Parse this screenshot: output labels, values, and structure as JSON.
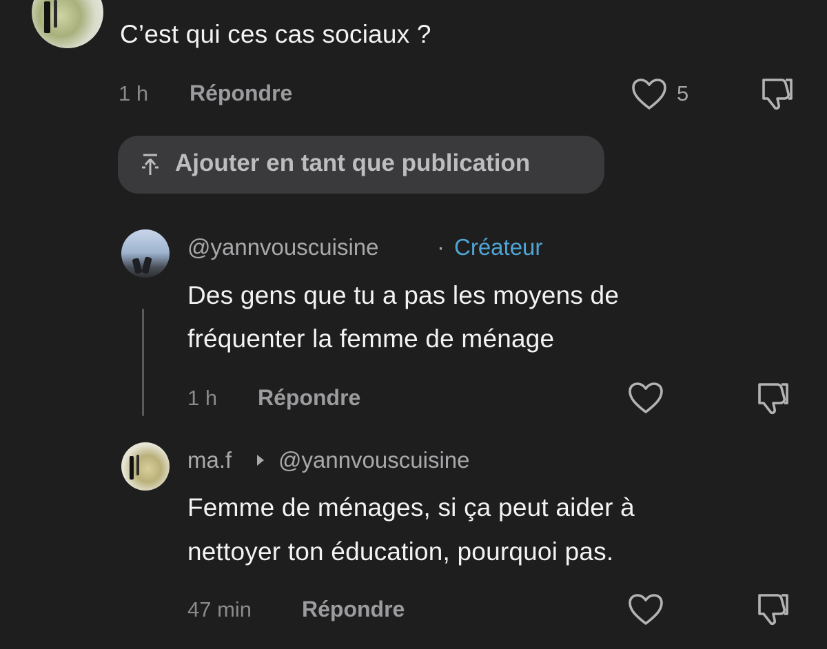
{
  "top_comment": {
    "text": "C’est qui ces cas sociaux ?",
    "time": "1 h",
    "reply_label": "Répondre",
    "like_count": "5",
    "add_as_post_label": "Ajouter en tant que publication"
  },
  "replies": [
    {
      "username": "@yannvouscuisine",
      "separator": "·",
      "badge": "Créateur",
      "text_line1": "Des gens que tu a pas les moyens de",
      "text_line2": "fréquenter la femme de ménage",
      "time": "1 h",
      "reply_label": "Répondre"
    },
    {
      "username": "ma.f",
      "reply_to": "@yannvouscuisine",
      "text_line1": "Femme de ménages, si ça peut aider à",
      "text_line2": "nettoyer ton éducation, pourquoi pas.",
      "time": "47 min",
      "reply_label": "Répondre"
    }
  ],
  "colors": {
    "background": "#1e1e1f",
    "creator_badge": "#4fa6d6"
  },
  "icons": [
    "heart-icon",
    "dislike-icon",
    "pin-icon",
    "reply-arrow-icon"
  ]
}
